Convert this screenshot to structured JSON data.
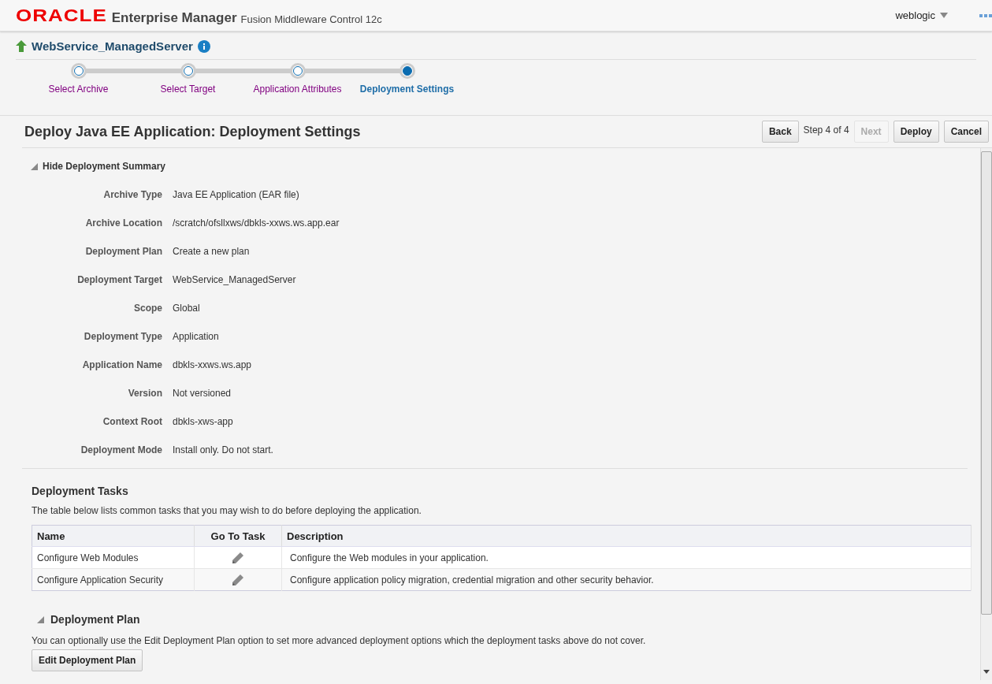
{
  "header": {
    "logo": "ORACLE",
    "product": "Enterprise Manager",
    "subtitle": "Fusion Middleware Control 12c",
    "user": "weblogic"
  },
  "target": {
    "name": "WebService_ManagedServer"
  },
  "train": [
    {
      "label": "Select Archive",
      "selected": false
    },
    {
      "label": "Select Target",
      "selected": false
    },
    {
      "label": "Application Attributes",
      "selected": false
    },
    {
      "label": "Deployment Settings",
      "selected": true
    }
  ],
  "page_title": "Deploy Java EE Application: Deployment Settings",
  "nav": [
    {
      "kind": "button",
      "label": "Back",
      "disabled": false
    },
    {
      "kind": "text",
      "label": "Step 4 of 4"
    },
    {
      "kind": "button",
      "label": "Next",
      "disabled": true
    },
    {
      "kind": "button",
      "label": "Deploy",
      "disabled": false
    },
    {
      "kind": "button",
      "label": "Cancel",
      "disabled": false
    }
  ],
  "summary": {
    "toggle": "Hide Deployment Summary",
    "expanded": true,
    "fields": [
      {
        "label": "Archive Type",
        "value": "Java EE Application (EAR file)"
      },
      {
        "label": "Archive Location",
        "value": "/scratch/ofsllxws/dbkls-xxws.ws.app.ear"
      },
      {
        "label": "Deployment Plan",
        "value": "Create a new plan"
      },
      {
        "label": "Deployment Target",
        "value": "WebService_ManagedServer"
      },
      {
        "label": "Scope",
        "value": "Global"
      },
      {
        "label": "Deployment Type",
        "value": "Application"
      },
      {
        "label": "Application Name",
        "value": "dbkls-xxws.ws.app"
      },
      {
        "label": "Version",
        "value": "Not versioned"
      },
      {
        "label": "Context Root",
        "value": "dbkls-xws-app"
      },
      {
        "label": "Deployment Mode",
        "value": "Install only. Do not start."
      }
    ]
  },
  "tasks": {
    "title": "Deployment Tasks",
    "intro": "The table below lists common tasks that you may wish to do before deploying the application.",
    "columns": [
      "Name",
      "Go To Task",
      "Description"
    ],
    "rows": [
      {
        "name": "Configure Web Modules",
        "description": "Configure the Web modules in your application."
      },
      {
        "name": "Configure Application Security",
        "description": "Configure application policy migration, credential migration and other security behavior."
      }
    ]
  },
  "plan": {
    "title": "Deployment Plan",
    "expanded": true,
    "text": "You can optionally use the Edit Deployment Plan option to set more advanced deployment options which the deployment tasks above do not cover.",
    "button": "Edit Deployment Plan"
  }
}
